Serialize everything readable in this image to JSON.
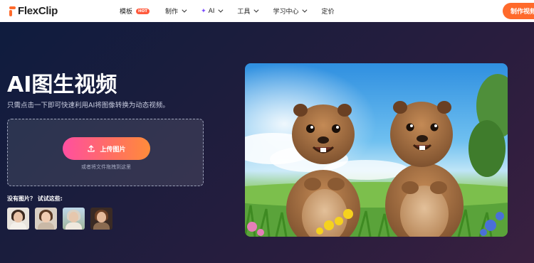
{
  "header": {
    "logo_text": "FlexClip",
    "nav": [
      {
        "label": "模板",
        "badge": "HOT",
        "has_chevron": false
      },
      {
        "label": "制作",
        "has_chevron": true
      },
      {
        "label": "AI",
        "has_chevron": true,
        "icon": "sparkle-icon"
      },
      {
        "label": "工具",
        "has_chevron": true
      },
      {
        "label": "学习中心",
        "has_chevron": true
      },
      {
        "label": "定价",
        "has_chevron": false
      }
    ],
    "make_video_label": "制作视频"
  },
  "hero": {
    "title": "AI图生视频",
    "subtitle": "只需点击一下即可快速利用AI将图像转换为动态视频。"
  },
  "upload": {
    "button_label": "上传图片",
    "hint": "或者将文件拖拽到这里"
  },
  "samples": {
    "label": "没有图片？ 试试这些:",
    "count": 4
  },
  "colors": {
    "brand_orange": "#ff6a2b",
    "upload_gradient_start": "#ff4fa0",
    "upload_gradient_end": "#ff8c3a"
  }
}
